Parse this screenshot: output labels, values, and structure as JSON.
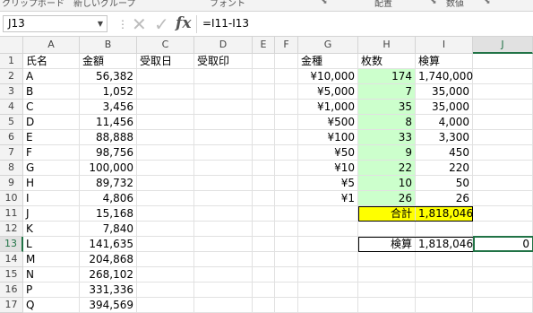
{
  "ribbon": {
    "groups": [
      "クリップボード",
      "新しいグループ",
      "フォント",
      "配置",
      "数値"
    ]
  },
  "formula_bar": {
    "name_box": "J13",
    "cancel_icon": "✕",
    "enter_icon": "✓",
    "fx_label": "fx",
    "formula": "=I11-I13"
  },
  "columns": [
    "A",
    "B",
    "C",
    "D",
    "E",
    "F",
    "G",
    "H",
    "I",
    "J"
  ],
  "rows": [
    "1",
    "2",
    "3",
    "4",
    "5",
    "6",
    "7",
    "8",
    "9",
    "10",
    "11",
    "12",
    "13",
    "14",
    "15",
    "16",
    "17"
  ],
  "active_cell": "J13",
  "sheet": {
    "A": [
      "氏名",
      "A",
      "B",
      "C",
      "D",
      "E",
      "F",
      "G",
      "H",
      "I",
      "J",
      "K",
      "L",
      "M",
      "N",
      "P",
      "Q"
    ],
    "B": [
      "金額",
      "56,382",
      "1,052",
      "3,456",
      "11,456",
      "88,888",
      "98,756",
      "100,000",
      "89,732",
      "4,806",
      "15,168",
      "7,840",
      "141,635",
      "204,868",
      "268,102",
      "331,336",
      "394,569"
    ],
    "C": [
      "受取日"
    ],
    "D": [
      "受取印"
    ],
    "G": [
      "金種",
      "¥10,000",
      "¥5,000",
      "¥1,000",
      "¥500",
      "¥100",
      "¥50",
      "¥10",
      "¥5",
      "¥1"
    ],
    "H": [
      "枚数",
      "174",
      "7",
      "35",
      "8",
      "33",
      "9",
      "22",
      "10",
      "26"
    ],
    "I": [
      "検算",
      "1,740,000",
      "35,000",
      "35,000",
      "4,000",
      "3,300",
      "450",
      "220",
      "50",
      "26"
    ],
    "total_label": "合計",
    "total_value": "1,818,046",
    "check_label": "検算",
    "check_value": "1,818,046",
    "diff_value": "0"
  }
}
